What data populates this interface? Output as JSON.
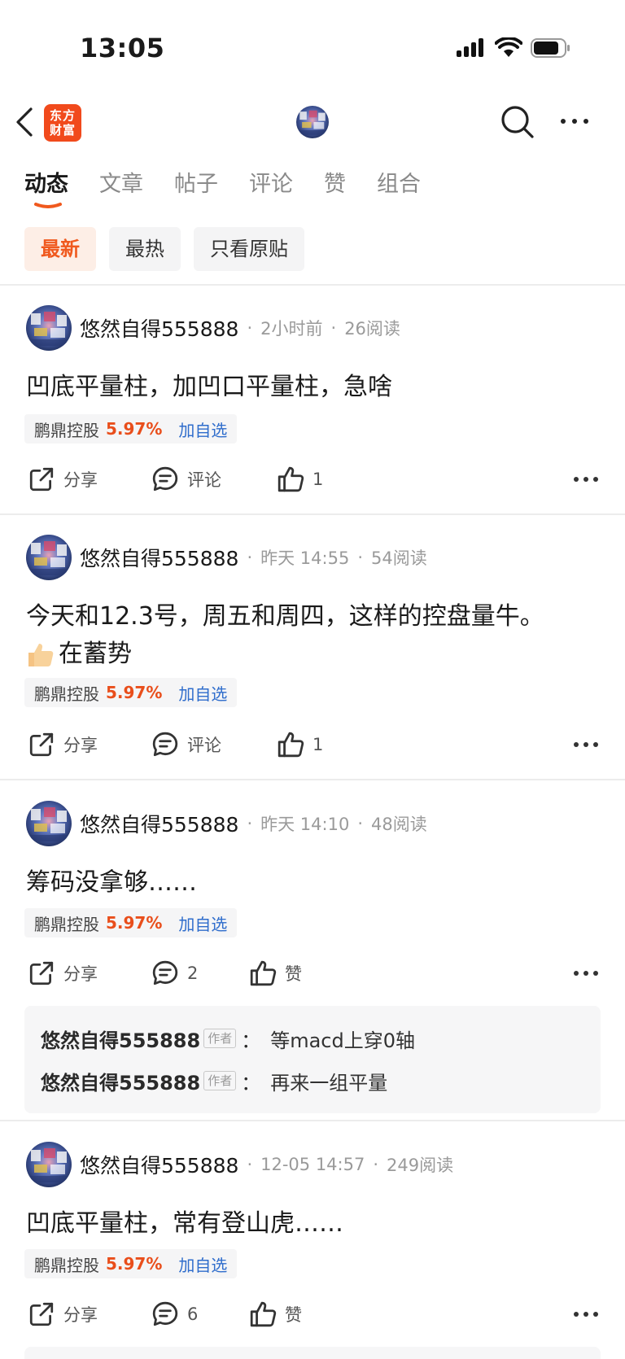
{
  "status": {
    "time": "13:05"
  },
  "nav": {
    "logo_line1": "东方",
    "logo_line2": "财富"
  },
  "tabs": [
    {
      "label": "动态",
      "active": true
    },
    {
      "label": "文章"
    },
    {
      "label": "帖子"
    },
    {
      "label": "评论"
    },
    {
      "label": "赞"
    },
    {
      "label": "组合"
    }
  ],
  "filters": [
    {
      "label": "最新",
      "active": true
    },
    {
      "label": "最热"
    },
    {
      "label": "只看原贴"
    }
  ],
  "colors": {
    "accent": "#f0591e",
    "up": "#e94e1b",
    "link": "#2f6dcc"
  },
  "posts": [
    {
      "user": "悠然自得555888",
      "time": "2小时前",
      "reads": "26阅读",
      "content": "凹底平量柱，加凹口平量柱，急啥",
      "stock": {
        "name": "鹏鼎控股",
        "change": "5.97%",
        "add": "加自选"
      },
      "share": "分享",
      "comment": "评论",
      "like": "1"
    },
    {
      "user": "悠然自得555888",
      "time": "昨天 14:55",
      "reads": "54阅读",
      "content": "今天和12.3号，周五和周四，这样的控盘量牛。",
      "content2": "在蓄势",
      "stock": {
        "name": "鹏鼎控股",
        "change": "5.97%",
        "add": "加自选"
      },
      "share": "分享",
      "comment": "评论",
      "like": "1"
    },
    {
      "user": "悠然自得555888",
      "time": "昨天 14:10",
      "reads": "48阅读",
      "content": "筹码没拿够……",
      "stock": {
        "name": "鹏鼎控股",
        "change": "5.97%",
        "add": "加自选"
      },
      "share": "分享",
      "comment": "2",
      "like": "赞",
      "comments": [
        {
          "user": "悠然自得555888",
          "badge": "作者",
          "colon": "：",
          "text": "等macd上穿0轴"
        },
        {
          "user": "悠然自得555888",
          "badge": "作者",
          "colon": "：",
          "text": "再来一组平量"
        }
      ]
    },
    {
      "user": "悠然自得555888",
      "time": "12-05 14:57",
      "reads": "249阅读",
      "content": "凹底平量柱，常有登山虎……",
      "stock": {
        "name": "鹏鼎控股",
        "change": "5.97%",
        "add": "加自选"
      },
      "share": "分享",
      "comment": "6",
      "like": "赞"
    }
  ],
  "icons": {
    "back": "chevron-left-icon",
    "search": "search-icon",
    "more": "more-dots-icon",
    "share": "share-icon",
    "comment": "comment-icon",
    "like": "thumbs-up-icon",
    "emoji": "thumbs-up-emoji"
  }
}
